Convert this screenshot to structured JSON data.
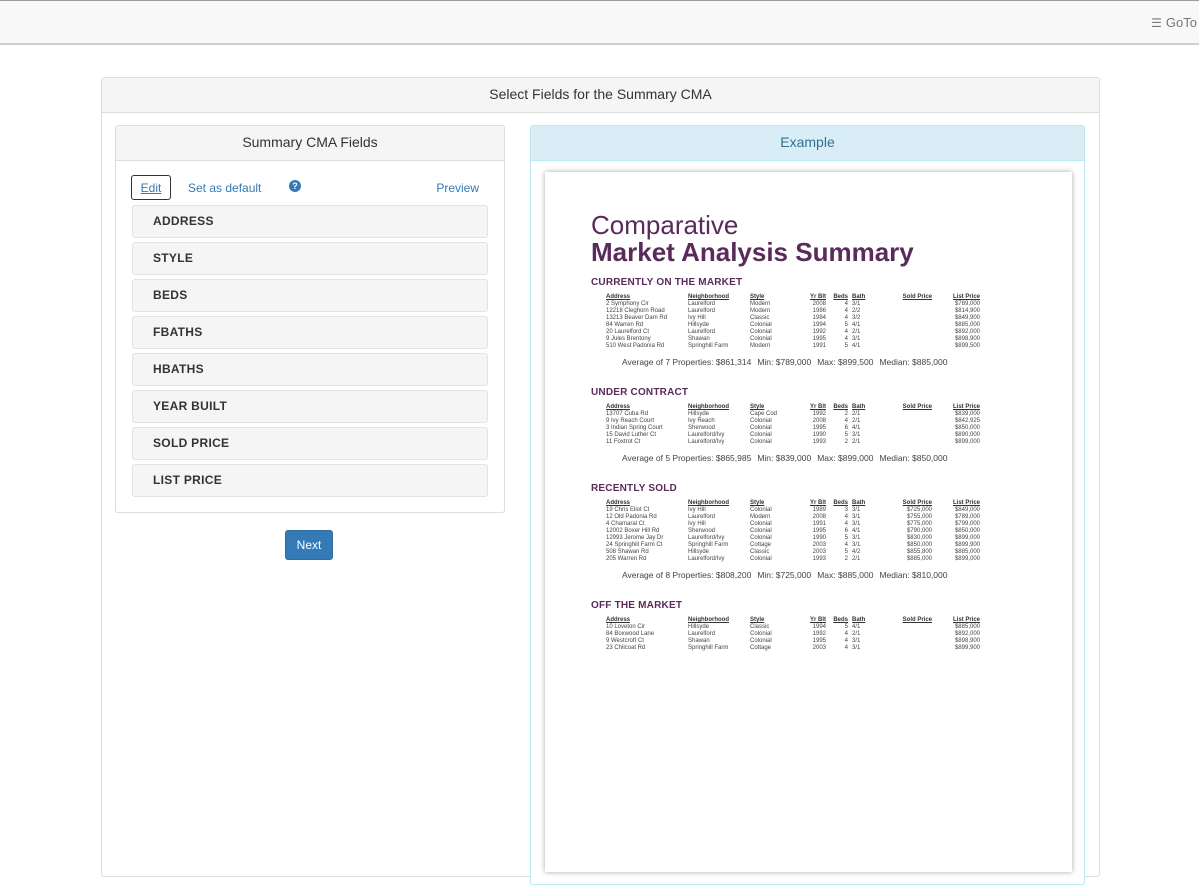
{
  "topbar": {
    "goto_label": "GoTo",
    "menu_glyph": "☰"
  },
  "outer": {
    "title": "Select Fields for the Summary CMA"
  },
  "left": {
    "title": "Summary CMA Fields",
    "edit_label": "Edit",
    "set_default_label": "Set as default",
    "help_glyph": "?",
    "preview_label": "Preview",
    "fields": [
      "ADDRESS",
      "STYLE",
      "BEDS",
      "FBATHS",
      "HBATHS",
      "YEAR BUILT",
      "SOLD PRICE",
      "LIST PRICE"
    ]
  },
  "next_label": "Next",
  "right": {
    "title": "Example"
  },
  "example_doc": {
    "title_line1": "Comparative",
    "title_line2": "Market Analysis Summary",
    "columns": [
      "Address",
      "Neighborhood",
      "Style",
      "Yr Blt",
      "Beds",
      "Bath",
      "Sold Price",
      "List Price"
    ],
    "sections": [
      {
        "heading": "CURRENTLY ON THE MARKET",
        "rows": [
          [
            "2 Symphony Cir",
            "Laurelford",
            "Modern",
            "2008",
            "4",
            "3/1",
            "",
            "$789,000"
          ],
          [
            "12218 Cleghorn Road",
            "Laurelford",
            "Modern",
            "1986",
            "4",
            "2/2",
            "",
            "$814,900"
          ],
          [
            "13213 Beaver Dam Rd",
            "Ivy Hill",
            "Classic",
            "1984",
            "4",
            "3/2",
            "",
            "$849,900"
          ],
          [
            "84 Warren Rd",
            "Hillsyde",
            "Colonial",
            "1994",
            "5",
            "4/1",
            "",
            "$885,000"
          ],
          [
            "20 Laurelford Ct",
            "Laurelford",
            "Colonial",
            "1992",
            "4",
            "2/1",
            "",
            "$892,000"
          ],
          [
            "9 Jules Brentony",
            "Shawan",
            "Colonial",
            "1995",
            "4",
            "3/1",
            "",
            "$898,900"
          ],
          [
            "510 West Padonia Rd",
            "Springhill Farm",
            "Modern",
            "1991",
            "5",
            "4/1",
            "",
            "$899,500"
          ]
        ],
        "summary": [
          "Average of 7 Properties: $861,314",
          "Min: $789,000",
          "Max: $899,500",
          "Median: $885,000"
        ]
      },
      {
        "heading": "UNDER CONTRACT",
        "rows": [
          [
            "13707 Cuba Rd",
            "Hillsyde",
            "Cape Cod",
            "1992",
            "2",
            "2/1",
            "",
            "$839,000"
          ],
          [
            "9 Ivy Reach Court",
            "Ivy Reach",
            "Colonial",
            "2008",
            "4",
            "2/1",
            "",
            "$842,925"
          ],
          [
            "3 Indian Spring Court",
            "Sherwood",
            "Colonial",
            "1995",
            "6",
            "4/1",
            "",
            "$850,000"
          ],
          [
            "15 David Luther Ct",
            "Laurelford/Ivy",
            "Colonial",
            "1990",
            "5",
            "3/1",
            "",
            "$890,000"
          ],
          [
            "11 Foxtrot Ct",
            "Laurelford/Ivy",
            "Colonial",
            "1993",
            "2",
            "2/1",
            "",
            "$899,000"
          ]
        ],
        "summary": [
          "Average of 5 Properties: $865,985",
          "Min: $839,000",
          "Max: $899,000",
          "Median: $850,000"
        ]
      },
      {
        "heading": "RECENTLY SOLD",
        "rows": [
          [
            "19 Chris Eliot Ct",
            "Ivy Hill",
            "Colonial",
            "1989",
            "3",
            "3/1",
            "$725,000",
            "$849,000"
          ],
          [
            "12 Old Padonia Rd",
            "Laurelford",
            "Modern",
            "2008",
            "4",
            "3/1",
            "$755,000",
            "$789,000"
          ],
          [
            "4 Chamaral Ct",
            "Ivy Hill",
            "Colonial",
            "1991",
            "4",
            "3/1",
            "$775,000",
            "$799,000"
          ],
          [
            "12002 Boxer Hill Rd",
            "Sherwood",
            "Colonial",
            "1995",
            "6",
            "4/1",
            "$790,000",
            "$850,000"
          ],
          [
            "12993 Jerome Jay Dr",
            "Laurelford/Ivy",
            "Colonial",
            "1990",
            "5",
            "3/1",
            "$830,000",
            "$899,000"
          ],
          [
            "24 Springhill Farm Ct",
            "Springhill Farm",
            "Cottage",
            "2003",
            "4",
            "3/1",
            "$850,000",
            "$899,900"
          ],
          [
            "508 Shawan Rd",
            "Hillsyde",
            "Classic",
            "2003",
            "5",
            "4/2",
            "$855,800",
            "$885,000"
          ],
          [
            "205 Warren Rd",
            "Laurelford/Ivy",
            "Colonial",
            "1993",
            "2",
            "2/1",
            "$885,000",
            "$899,000"
          ]
        ],
        "summary": [
          "Average of 8 Properties: $808,200",
          "Min: $725,000",
          "Max: $885,000",
          "Median: $810,000"
        ]
      },
      {
        "heading": "OFF THE MARKET",
        "rows": [
          [
            "10 Loveton Cir",
            "Hillsyde",
            "Classic",
            "1994",
            "5",
            "4/1",
            "",
            "$885,000"
          ],
          [
            "84 Boxwood Lane",
            "Laurelford",
            "Colonial",
            "1992",
            "4",
            "2/1",
            "",
            "$892,000"
          ],
          [
            "9 Westcroft Ct",
            "Shawan",
            "Colonial",
            "1995",
            "4",
            "3/1",
            "",
            "$898,900"
          ],
          [
            "23 Chilcoat Rd",
            "Springhill Farm",
            "Cottage",
            "2003",
            "4",
            "3/1",
            "",
            "$899,900"
          ]
        ],
        "summary": []
      }
    ]
  }
}
